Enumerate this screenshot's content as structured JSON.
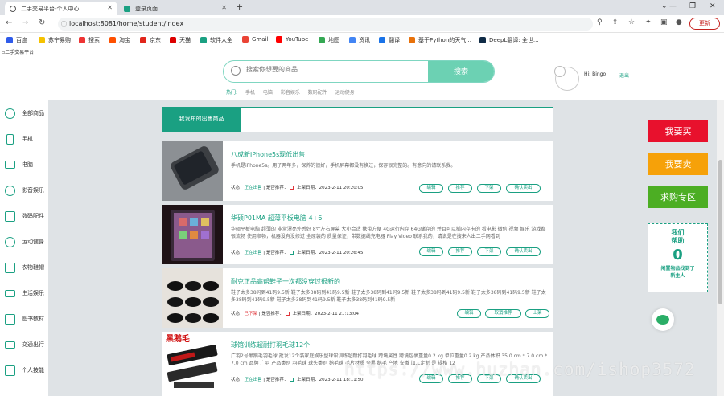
{
  "browser": {
    "tabs": [
      {
        "title": "二手交易平台-个人中心",
        "active": true
      },
      {
        "title": "登录页面",
        "active": false
      }
    ],
    "url": "localhost:8081/home/student/index",
    "update_label": "更新",
    "bookmarks": [
      "百度",
      "苏宁易购",
      "搜索",
      "淘宝",
      "京东",
      "天猫",
      "软件大全",
      "Gmail",
      "YouTube",
      "地图",
      "资讯",
      "翻译",
      "基于Python的天气...",
      "DeepL翻译: 全世..."
    ]
  },
  "header": {
    "logo_alt": "二手交易平台",
    "search_placeholder": "搜索你想要的商品",
    "search_button": "搜索",
    "hot_label": "热门:",
    "hot_tags": [
      "手机",
      "电脑",
      "影音娱乐",
      "数码配件",
      "运动健身"
    ],
    "greeting": "Hi: Bingo",
    "logout": "退出"
  },
  "sidebar": {
    "items": [
      "全部商品",
      "手机",
      "电脑",
      "影音娱乐",
      "数码配件",
      "运动健身",
      "衣物鞋帽",
      "生活娱乐",
      "图书教材",
      "交通出行",
      "个人技能"
    ]
  },
  "main": {
    "tab_label": "我发布的出售商品",
    "items": [
      {
        "title": "八成新iPhone5s现低出售",
        "desc": "手机是iPhone5s。用了两年多，保养的很好，手机屏幕都没有换过，保存很完整的。有意向的请联系我。",
        "status_label": "状态：",
        "status": "正在出售",
        "recommend": "| 是否推荐：",
        "date": "上架日期：2023-2-11 20:20:05",
        "actions": [
          "编辑",
          "推荐",
          "下架",
          "确认卖出"
        ]
      },
      {
        "title": "华硕P01MA 超薄平板电脑 4+6",
        "desc": "华硕平板电脑 超薄的 非常漂亮外感好 8寸左右屏幕 大小合适 携带方便 4G运行内存 64G储存的 并且可以插内存卡的 看电影 微信 视频 娱乐 游戏都很流畅 使用顺畅，机器没有没修过 全原装的 质量保证，带数据线充电器 Play Video 联系我的，请说是在搜来人出二手网看到",
        "status_label": "状态：",
        "status": "正在出售",
        "recommend": "| 是否推荐：",
        "date": "上架日期：2023-2-11 20:26:45",
        "actions": [
          "编辑",
          "推荐",
          "下架",
          "确认卖出"
        ]
      },
      {
        "title": "耐克正品高帮鞋子一次都没穿过很新的",
        "desc": "鞋子太多38码到41码9.5新 鞋子太多38码到41码9.5新 鞋子太多38码到41码9.5新 鞋子太多38码到41码9.5新 鞋子太多38码到41码9.5新 鞋子太多38码到41码9.5新 鞋子太多38码到41码9.5新 鞋子太多38码到41码9.5新",
        "status_label": "状态：",
        "status": "已下架",
        "recommend": "| 是否推荐：",
        "date": "上架日期：2023-2-11 21:13:04",
        "actions": [
          "编辑",
          "取消推荐",
          "上架"
        ]
      },
      {
        "title": "球馆训练超耐打羽毛球12个",
        "desc": "广羽2号黑鹅毛羽毛球 批发12个装家庭娱乐型球馆训练超耐打羽毛球 跨境属性 跨境包裹重量0.2 kg 单位重量0.2 kg 产品体积 35.0 cm * 7.0 cm * 7.0 cm 品牌 广羽 产品类别 羽毛球 球头类别 鹅毛球 毛片材质 全黑 鹅毛 产地 安徽 加工定制 是 规格 12",
        "status_label": "状态：",
        "status": "正在出售",
        "recommend": "| 是否推荐：",
        "date": "上架日期：2023-2-11 18:11:50",
        "actions": [
          "编辑",
          "推荐",
          "下架",
          "确认卖出"
        ]
      }
    ]
  },
  "right": {
    "buy": "我要买",
    "sell": "我要卖",
    "wanted": "求购专区",
    "help_title_1": "我们",
    "help_title_2": "帮助",
    "help_count": "0",
    "help_sub_1": "闲置物品找到了",
    "help_sub_2": "新主人"
  },
  "watermark": "https://www.huzhan.com/ishop3572",
  "colors": {
    "accent": "#1aa082",
    "buy": "#e8112d",
    "sell": "#f6a109",
    "wanted": "#4cae23"
  }
}
